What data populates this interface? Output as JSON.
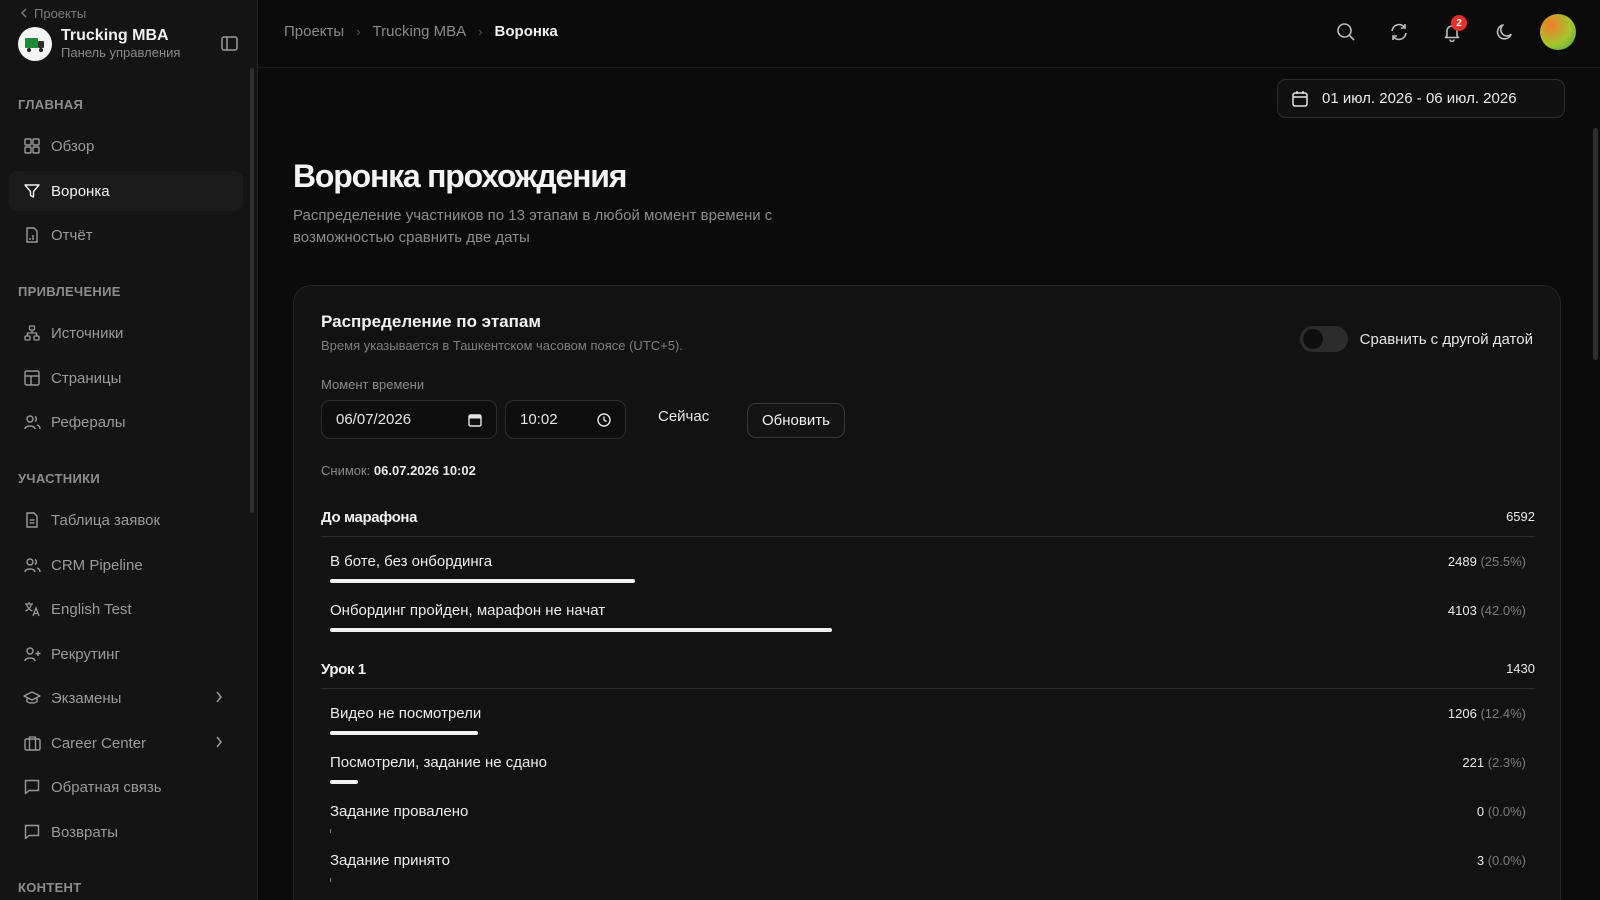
{
  "sidebar": {
    "back_label": "Проекты",
    "brand_title": "Trucking MBA",
    "brand_subtitle": "Панель управления",
    "sections": {
      "main": "ГЛАВНАЯ",
      "acquisition": "ПРИВЛЕЧЕНИЕ",
      "participants": "УЧАСТНИКИ",
      "content": "КОНТЕНТ"
    },
    "items": [
      {
        "label": "Обзор",
        "icon": "grid-icon"
      },
      {
        "label": "Воронка",
        "icon": "filter-icon",
        "active": true
      },
      {
        "label": "Отчёт",
        "icon": "report-icon"
      },
      {
        "label": "Источники",
        "icon": "network-icon"
      },
      {
        "label": "Страницы",
        "icon": "layout-icon"
      },
      {
        "label": "Рефералы",
        "icon": "users-icon"
      },
      {
        "label": "Таблица заявок",
        "icon": "document-icon"
      },
      {
        "label": "CRM Pipeline",
        "icon": "users-icon"
      },
      {
        "label": "English Test",
        "icon": "translate-icon"
      },
      {
        "label": "Рекрутинг",
        "icon": "user-plus-icon"
      },
      {
        "label": "Экзамены",
        "icon": "graduation-cap-icon"
      },
      {
        "label": "Career Center",
        "icon": "briefcase-icon"
      },
      {
        "label": "Обратная связь",
        "icon": "message-icon"
      },
      {
        "label": "Возвраты",
        "icon": "message-icon"
      }
    ]
  },
  "header": {
    "breadcrumb": [
      "Проекты",
      "Trucking MBA",
      "Воронка"
    ],
    "notifications_count": "2",
    "date_range": "01 июл. 2026 - 06 июл. 2026"
  },
  "page": {
    "title": "Воронка прохождения",
    "description": "Распределение участников по 13 этапам в любой момент времени с возможностью сравнить две даты"
  },
  "card": {
    "title": "Распределение по этапам",
    "subtitle": "Время указывается в Ташкентском часовом поясе (UTC+5).",
    "compare_label": "Сравнить с другой датой",
    "compare_enabled": false,
    "moment_label": "Момент времени",
    "date_value": "06/07/2026",
    "time_value": "10:02",
    "now_label": "Сейчас",
    "refresh_label": "Обновить",
    "snapshot_label": "Снимок:",
    "snapshot_value": "06.07.2026 10:02",
    "groups": [
      {
        "name": "До марафона",
        "total": "6592",
        "stages": [
          {
            "name": "В боте, без онбординга",
            "count": "2489",
            "pct": "(25.5%)",
            "share": 0.255
          },
          {
            "name": "Онбординг пройден, марафон не начат",
            "count": "4103",
            "pct": "(42.0%)",
            "share": 0.42
          }
        ]
      },
      {
        "name": "Урок 1",
        "total": "1430",
        "stages": [
          {
            "name": "Видео не посмотрели",
            "count": "1206",
            "pct": "(12.4%)",
            "share": 0.124
          },
          {
            "name": "Посмотрели, задание не сдано",
            "count": "221",
            "pct": "(2.3%)",
            "share": 0.023
          },
          {
            "name": "Задание провалено",
            "count": "0",
            "pct": "(0.0%)",
            "share": 0.0
          },
          {
            "name": "Задание принято",
            "count": "3",
            "pct": "(0.0%)",
            "share": 0.0
          }
        ]
      }
    ]
  }
}
